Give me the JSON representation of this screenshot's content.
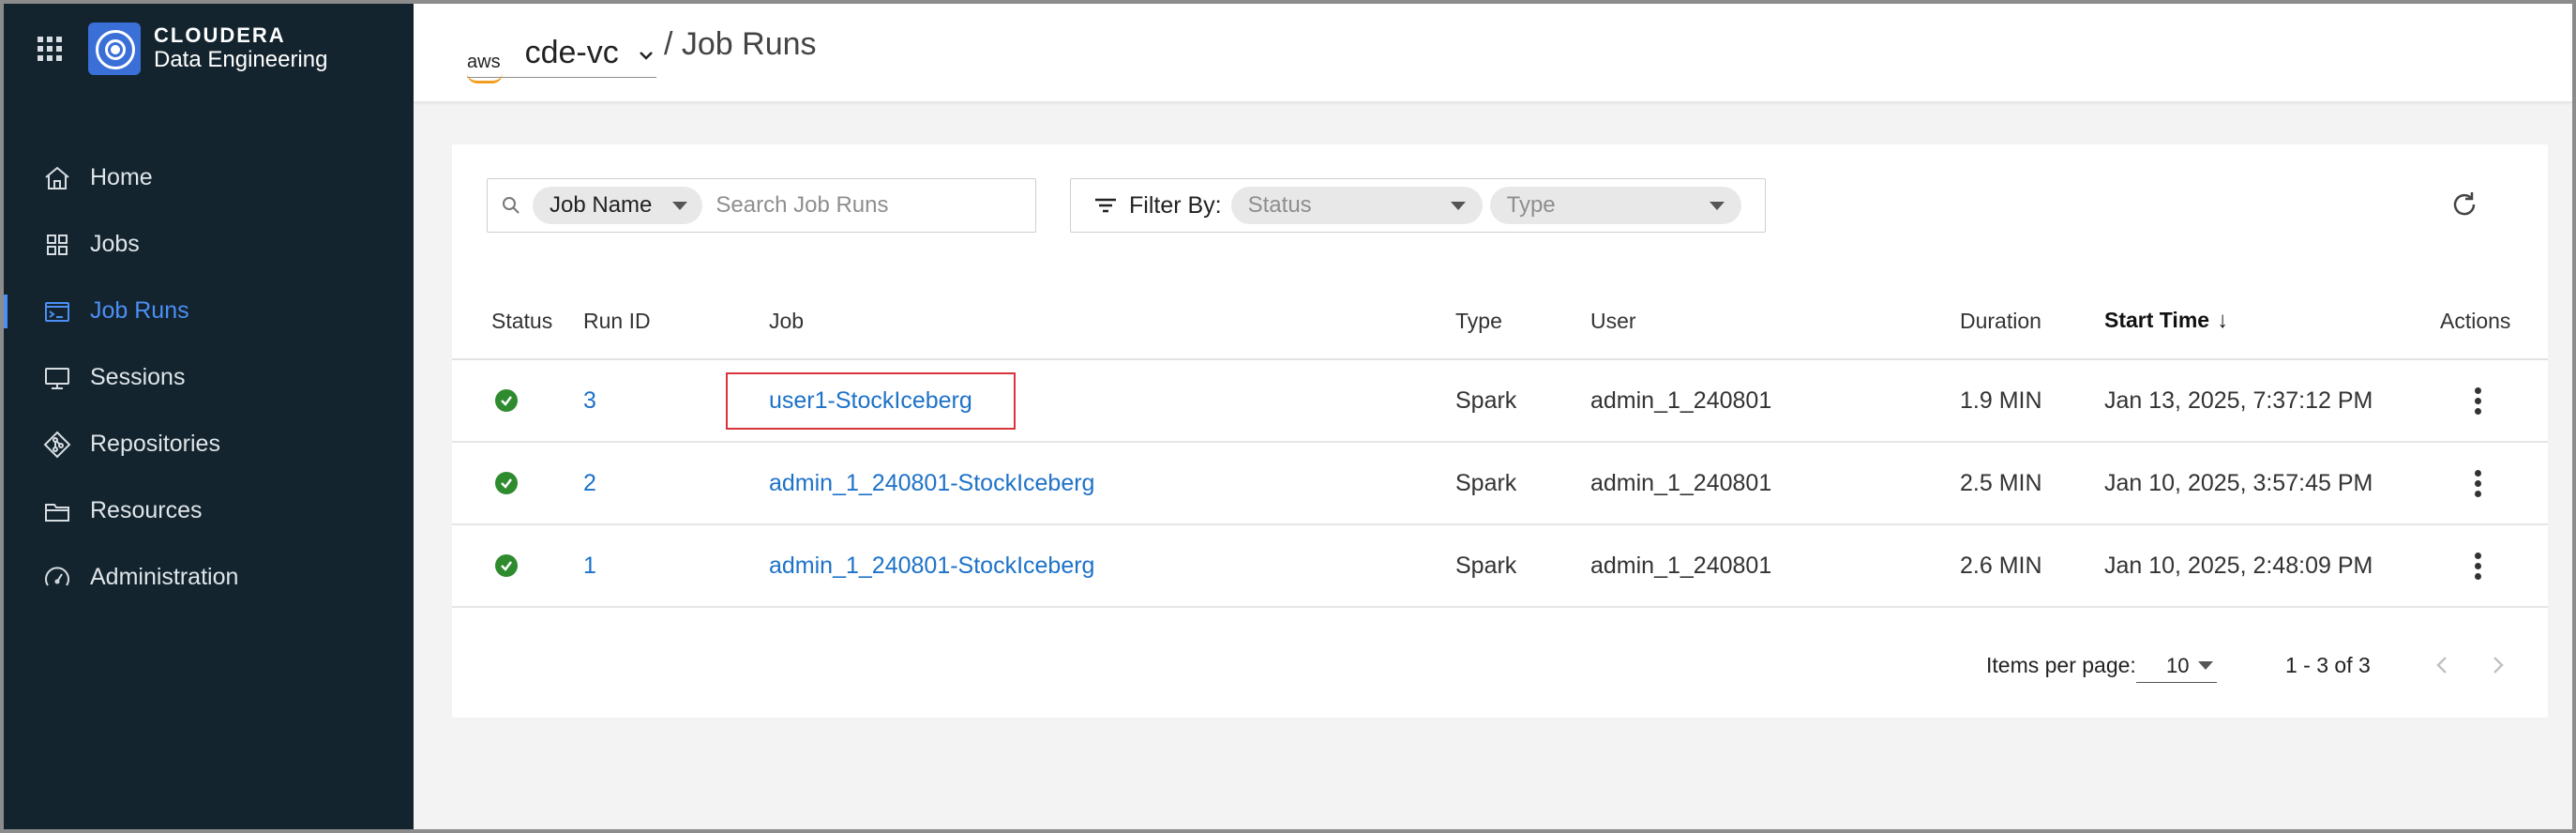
{
  "brand": {
    "line1": "CLOUDERA",
    "line2": "Data Engineering"
  },
  "sidebar": {
    "items": [
      {
        "label": "Home",
        "icon": "home-icon",
        "active": false
      },
      {
        "label": "Jobs",
        "icon": "grid-icon",
        "active": false
      },
      {
        "label": "Job Runs",
        "icon": "job-runs-icon",
        "active": true
      },
      {
        "label": "Sessions",
        "icon": "monitor-icon",
        "active": false
      },
      {
        "label": "Repositories",
        "icon": "git-icon",
        "active": false
      },
      {
        "label": "Resources",
        "icon": "folder-icon",
        "active": false
      },
      {
        "label": "Administration",
        "icon": "gauge-icon",
        "active": false
      }
    ]
  },
  "header": {
    "provider": "aws",
    "environment": "cde-vc",
    "breadcrumb": "/ Job Runs"
  },
  "toolbar": {
    "search_field": "Job Name",
    "search_placeholder": "Search Job Runs",
    "filter_label": "Filter By:",
    "status_placeholder": "Status",
    "type_placeholder": "Type"
  },
  "table": {
    "columns": [
      "Status",
      "Run ID",
      "Job",
      "Type",
      "User",
      "Duration",
      "Start Time",
      "Actions"
    ],
    "sorted_column": "Start Time",
    "rows": [
      {
        "run_id": "3",
        "job": "user1-StockIceberg",
        "type": "Spark",
        "user": "admin_1_240801",
        "duration": "1.9 MIN",
        "start": "Jan 13, 2025, 7:37:12 PM",
        "highlighted": true
      },
      {
        "run_id": "2",
        "job": "admin_1_240801-StockIceberg",
        "type": "Spark",
        "user": "admin_1_240801",
        "duration": "2.5 MIN",
        "start": "Jan 10, 2025, 3:57:45 PM",
        "highlighted": false
      },
      {
        "run_id": "1",
        "job": "admin_1_240801-StockIceberg",
        "type": "Spark",
        "user": "admin_1_240801",
        "duration": "2.6 MIN",
        "start": "Jan 10, 2025, 2:48:09 PM",
        "highlighted": false
      }
    ]
  },
  "pagination": {
    "items_label": "Items per page:",
    "items_value": "10",
    "range": "1 - 3 of 3"
  },
  "colors": {
    "sidebar_bg": "#13242e",
    "accent": "#4c8ff5",
    "link": "#1d72c8",
    "success": "#2e8b2e",
    "highlight": "#d8343c"
  }
}
